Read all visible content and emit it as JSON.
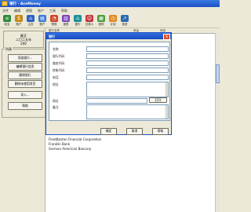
{
  "app": {
    "title": "银行 - AceMoney"
  },
  "menu": [
    "文件",
    "编辑",
    "视图",
    "账户",
    "工具",
    "帮助"
  ],
  "toolbar": [
    {
      "label": "收支",
      "icon": "ledger-icon",
      "color": "#2e8b3a"
    },
    {
      "label": "账户",
      "icon": "accounts-icon",
      "color": "#c48a18"
    },
    {
      "label": "主页",
      "icon": "home-icon",
      "color": "#2d62c4"
    },
    {
      "label": "账户",
      "icon": "account-icon",
      "color": "#3a7bd5"
    },
    {
      "label": "预算",
      "icon": "budget-icon",
      "color": "#d3452c"
    },
    {
      "label": "报表",
      "icon": "report-icon",
      "color": "#7a43b8"
    },
    {
      "label": "银行",
      "icon": "bank-icon",
      "color": "#1f8f9a"
    },
    {
      "label": "交易人",
      "icon": "payee-icon",
      "color": "#c0393b"
    },
    {
      "label": "类别",
      "icon": "category-icon",
      "color": "#4a9d3c"
    },
    {
      "label": "计划",
      "icon": "schedule-icon",
      "color": "#e08a1e"
    },
    {
      "label": "投资",
      "icon": "invest-icon",
      "color": "#2b6cb0"
    }
  ],
  "left_panel": {
    "summary_title": "截至",
    "summary_date": "二〇二五年",
    "summary_count": "200",
    "buttons": [
      "添加银行...",
      "编辑银行信息",
      "删除银行",
      "删除未使用项目",
      "导入...",
      "帮助"
    ],
    "group_label": "列表"
  },
  "table": {
    "columns": [
      "银行名称",
      "电话",
      "传真"
    ],
    "rows": [
      "FleetBoston Financial Corporation",
      "Franklin Bank",
      "German American Bancorp"
    ]
  },
  "dialog": {
    "title": "银行",
    "fields": [
      "名称",
      "银行代码",
      "路由代码",
      "转账代码",
      "电话",
      "地址",
      "网址",
      "备注"
    ],
    "open_label": "打开",
    "ok_label": "确定",
    "cancel_label": "取消",
    "help_label": "帮助"
  }
}
